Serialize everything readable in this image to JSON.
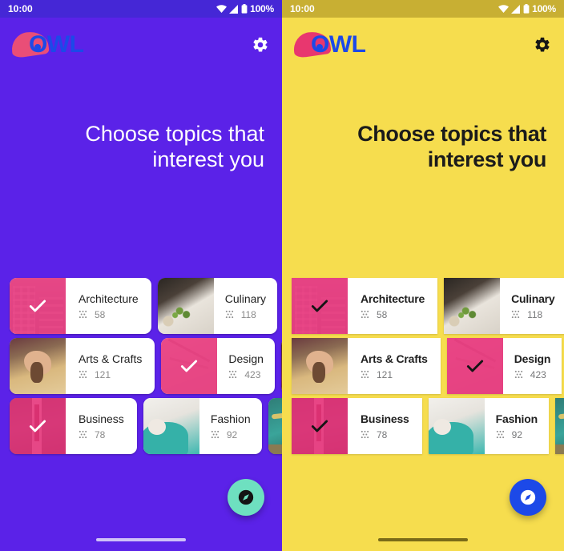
{
  "panels": [
    {
      "id": "purple-theme",
      "theme_name": "purple",
      "bg_color": "#5B22E8",
      "statusbar": {
        "time": "10:00",
        "battery": "100%",
        "wifi_icon": "wifi-icon",
        "signal_icon": "signal-icon",
        "battery_icon": "battery-icon"
      },
      "brand": {
        "name": "OWL",
        "logo_icon": "owl-logo-icon",
        "settings_icon": "gear-icon"
      },
      "headline": "Choose topics that interest you",
      "fab": {
        "icon": "explore-compass-icon",
        "color": "#6EE0C0"
      },
      "topics": [
        {
          "name": "Architecture",
          "count": "58",
          "selected": true,
          "image": "architecture",
          "icon": "grain-icon"
        },
        {
          "name": "Culinary",
          "count": "118",
          "selected": false,
          "image": "culinary",
          "icon": "grain-icon"
        },
        {
          "name": "Arts & Crafts",
          "count": "121",
          "selected": false,
          "image": "arts",
          "icon": "grain-icon"
        },
        {
          "name": "Design",
          "count": "423",
          "selected": true,
          "image": "design",
          "icon": "grain-icon"
        },
        {
          "name": "Business",
          "count": "78",
          "selected": true,
          "image": "business",
          "icon": "grain-icon"
        },
        {
          "name": "Fashion",
          "count": "92",
          "selected": false,
          "image": "fashion",
          "icon": "grain-icon"
        }
      ]
    },
    {
      "id": "yellow-theme",
      "theme_name": "yellow",
      "bg_color": "#F6DD4E",
      "statusbar": {
        "time": "10:00",
        "battery": "100%",
        "wifi_icon": "wifi-icon",
        "signal_icon": "signal-icon",
        "battery_icon": "battery-icon"
      },
      "brand": {
        "name": "OWL",
        "logo_icon": "owl-logo-icon",
        "settings_icon": "gear-icon"
      },
      "headline": "Choose topics that interest you",
      "fab": {
        "icon": "explore-compass-icon",
        "color": "#1C49E8"
      },
      "topics": [
        {
          "name": "Architecture",
          "count": "58",
          "selected": true,
          "image": "architecture",
          "icon": "grain-icon"
        },
        {
          "name": "Culinary",
          "count": "118",
          "selected": false,
          "image": "culinary",
          "icon": "grain-icon"
        },
        {
          "name": "Arts & Crafts",
          "count": "121",
          "selected": false,
          "image": "arts",
          "icon": "grain-icon"
        },
        {
          "name": "Design",
          "count": "423",
          "selected": true,
          "image": "design",
          "icon": "grain-icon"
        },
        {
          "name": "Business",
          "count": "78",
          "selected": true,
          "image": "business",
          "icon": "grain-icon"
        },
        {
          "name": "Fashion",
          "count": "92",
          "selected": false,
          "image": "fashion",
          "icon": "grain-icon"
        }
      ]
    }
  ]
}
